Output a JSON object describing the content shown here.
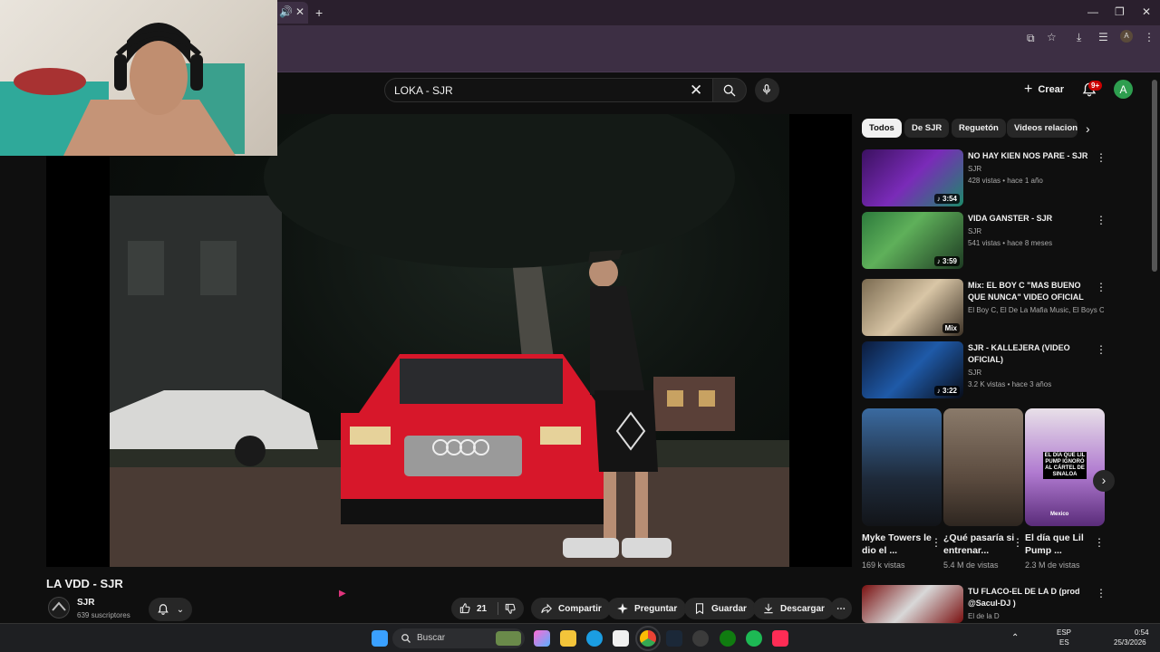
{
  "search": {
    "query": "LOKA - SJR"
  },
  "header": {
    "create_label": "Crear",
    "notif_count": "9+",
    "avatar_letter": "A"
  },
  "video": {
    "title": "LA VDD - SJR",
    "channel": "SJR",
    "subscribers": "639 suscriptores",
    "likes": "21"
  },
  "actions": {
    "share": "Compartir",
    "ask": "Preguntar",
    "save": "Guardar",
    "download": "Descargar"
  },
  "chips": [
    "Todos",
    "De SJR",
    "Reguetón",
    "Videos relacion"
  ],
  "recommendations": [
    {
      "title": "NO HAY KIEN NOS PARE - SJR",
      "channel": "SJR",
      "meta": "428 vistas • hace 1 año",
      "duration": "♪ 3:54"
    },
    {
      "title": "VIDA GANSTER - SJR",
      "channel": "SJR",
      "meta": "541 vistas • hace 8 meses",
      "duration": "♪ 3:59"
    },
    {
      "title": "Mix: EL BOY C \"MAS BUENO QUE NUNCA\" VIDEO OFICIAL",
      "channel": "El Boy C, El De La Mafia Music, El Boys C...",
      "meta": "",
      "duration": "Mix"
    },
    {
      "title": "SJR - KALLEJERA (VIDEO OFICIAL)",
      "channel": "SJR",
      "meta": "3.2 K vistas • hace 3 años",
      "duration": "♪ 3:22"
    }
  ],
  "shorts": [
    {
      "title": "Myke Towers le dio el ...",
      "views": "169 k vistas"
    },
    {
      "title": "¿Qué pasaría si entrenar...",
      "views": "5.4 M de vistas"
    },
    {
      "title": "El día que Lil Pump ...",
      "views": "2.3 M de vistas"
    }
  ],
  "short_overlay": {
    "caption": "EL DÍA QUE LIL PUMP IGNORÓ AL CÁRTEL DE SINALOA",
    "tag": "Mexico"
  },
  "last_rec": {
    "title": "TU FLACO-EL DE LA D (prod @Sacul-DJ )",
    "channel": "El de la D"
  },
  "taskbar": {
    "search_placeholder": "Buscar",
    "lang": "ESP",
    "lang2": "ES",
    "time": "0:54",
    "date": "25/3/2026"
  }
}
